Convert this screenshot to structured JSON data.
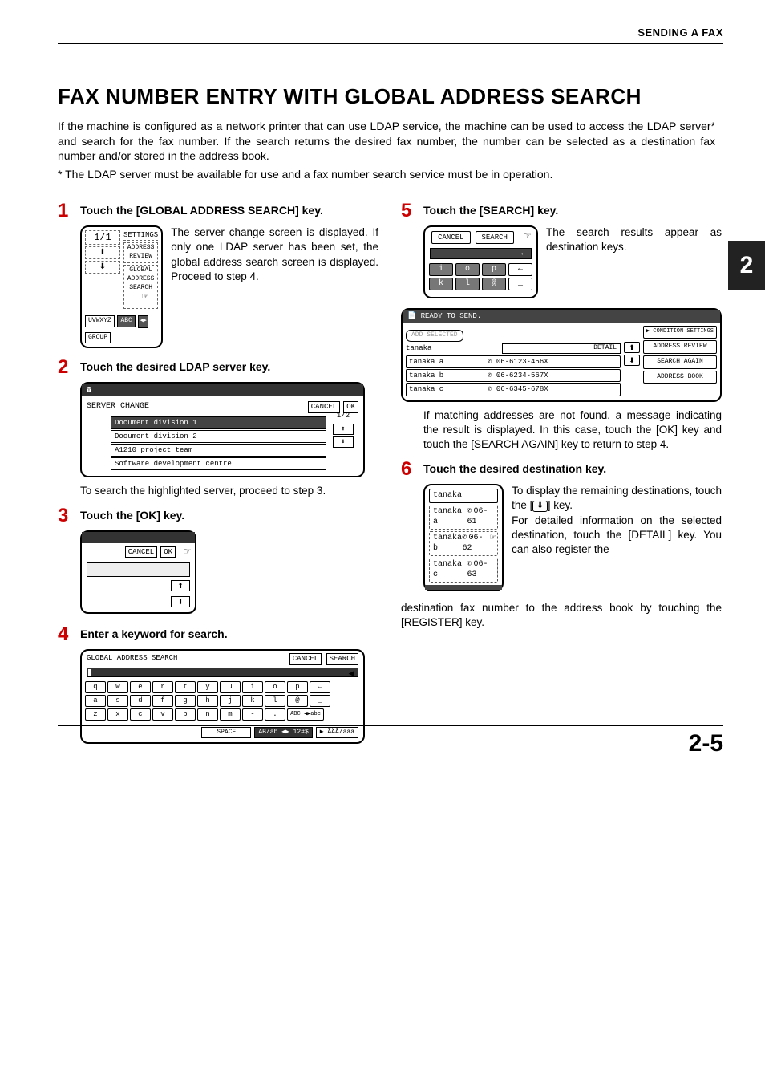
{
  "header": {
    "section": "SENDING A FAX"
  },
  "title": "FAX NUMBER ENTRY WITH GLOBAL ADDRESS SEARCH",
  "intro": "If the machine is configured as a network printer that can use LDAP service, the machine can be used to access the LDAP server* and search for the fax number. If the search returns the desired fax number, the number can be selected as a destination fax number and/or stored in the address book.",
  "footnote": "* The LDAP server must be available for use and a fax number search service must be in operation.",
  "step1": {
    "num": "1",
    "title": "Touch the [GLOBAL ADDRESS SEARCH] key.",
    "text": "The server change screen is displayed. If only one LDAP server has been set, the global address search screen is displayed. Proceed to step 4.",
    "panel": {
      "frac": "1/1",
      "up": "⬆",
      "down": "⬇",
      "settingsTitle": "SETTINGS",
      "item1": "ADDRESS REVIEW",
      "item2a": "GLOBAL",
      "item2b": "ADDRESS SEARCH",
      "bottomLeft": "UVWXYZ",
      "bottomMid": "ABC",
      "bottomRight": "GROUP",
      "arrowLR": "◀▶"
    }
  },
  "step2": {
    "num": "2",
    "title": "Touch the desired LDAP server key.",
    "afterText": "To search the highlighted server, proceed to step 3.",
    "panel": {
      "title": "SERVER CHANGE",
      "cancel": "CANCEL",
      "ok": "OK",
      "page": "1/2",
      "items": [
        "Document division 1",
        "Document division 2",
        "A1210 project team",
        "Software development centre"
      ],
      "up": "⬆",
      "down": "⬇"
    }
  },
  "step3": {
    "num": "3",
    "title": "Touch the [OK] key.",
    "panel": {
      "cancel": "CANCEL",
      "ok": "OK",
      "up": "⬆",
      "down": "⬇"
    }
  },
  "step4": {
    "num": "4",
    "title": "Enter a keyword for search.",
    "panel": {
      "title": "GLOBAL ADDRESS SEARCH",
      "cancel": "CANCEL",
      "search": "SEARCH",
      "rows": [
        [
          "q",
          "w",
          "e",
          "r",
          "t",
          "y",
          "u",
          "i",
          "o",
          "p",
          "←"
        ],
        [
          "a",
          "s",
          "d",
          "f",
          "g",
          "h",
          "j",
          "k",
          "l",
          "@",
          "_"
        ],
        [
          "z",
          "x",
          "c",
          "v",
          "b",
          "n",
          "m",
          "-",
          ".",
          "ABC ◀▶abc"
        ]
      ],
      "space": "SPACE",
      "mode1": "AB/ab ◀▶ 12#$",
      "mode2": "▶ ÃÄÂ/ãäâ"
    }
  },
  "step5": {
    "num": "5",
    "title": "Touch the [SEARCH] key.",
    "text": "The search results appear as destination keys.",
    "panel": {
      "cancel": "CANCEL",
      "search": "SEARCH",
      "rows": [
        [
          "i",
          "o",
          "p",
          "←"
        ],
        [
          "k",
          "l",
          "@",
          "_"
        ]
      ]
    },
    "results": {
      "status": "READY TO SEND.",
      "add": "ADD SELECTED",
      "cond": "CONDITION SETTINGS",
      "detail": "DETAIL",
      "addrReview": "ADDRESS REVIEW",
      "searchAgain": "SEARCH AGAIN",
      "addrBook": "ADDRESS BOOK",
      "query": "tanaka",
      "rows": [
        {
          "name": "tanaka a",
          "num": "06-6123-456X"
        },
        {
          "name": "tanaka b",
          "num": "06-6234-567X"
        },
        {
          "name": "tanaka c",
          "num": "06-6345-678X"
        }
      ],
      "up": "⬆",
      "down": "⬇"
    },
    "note": "If matching addresses are not found, a message indicating the result is displayed. In this case, touch the [OK] key and touch the [SEARCH AGAIN] key to return to step 4."
  },
  "step6": {
    "num": "6",
    "title": "Touch the desired destination key.",
    "textA": "To display the remaining destinations, touch the ",
    "keyGlyph": "⬇",
    "textA2": " key.",
    "textB": "For detailed information on the selected destination, touch the [DETAIL] key. You can also register the ",
    "textC": "destination fax number to the address book by touching the [REGISTER] key.",
    "panel": {
      "query": "tanaka",
      "rows": [
        {
          "name": "tanaka a",
          "num": "06-61"
        },
        {
          "name": "tanaka b",
          "num": "06-62"
        },
        {
          "name": "tanaka c",
          "num": "06-63"
        }
      ]
    }
  },
  "sideTab": "2",
  "pageNumber": "2-5"
}
